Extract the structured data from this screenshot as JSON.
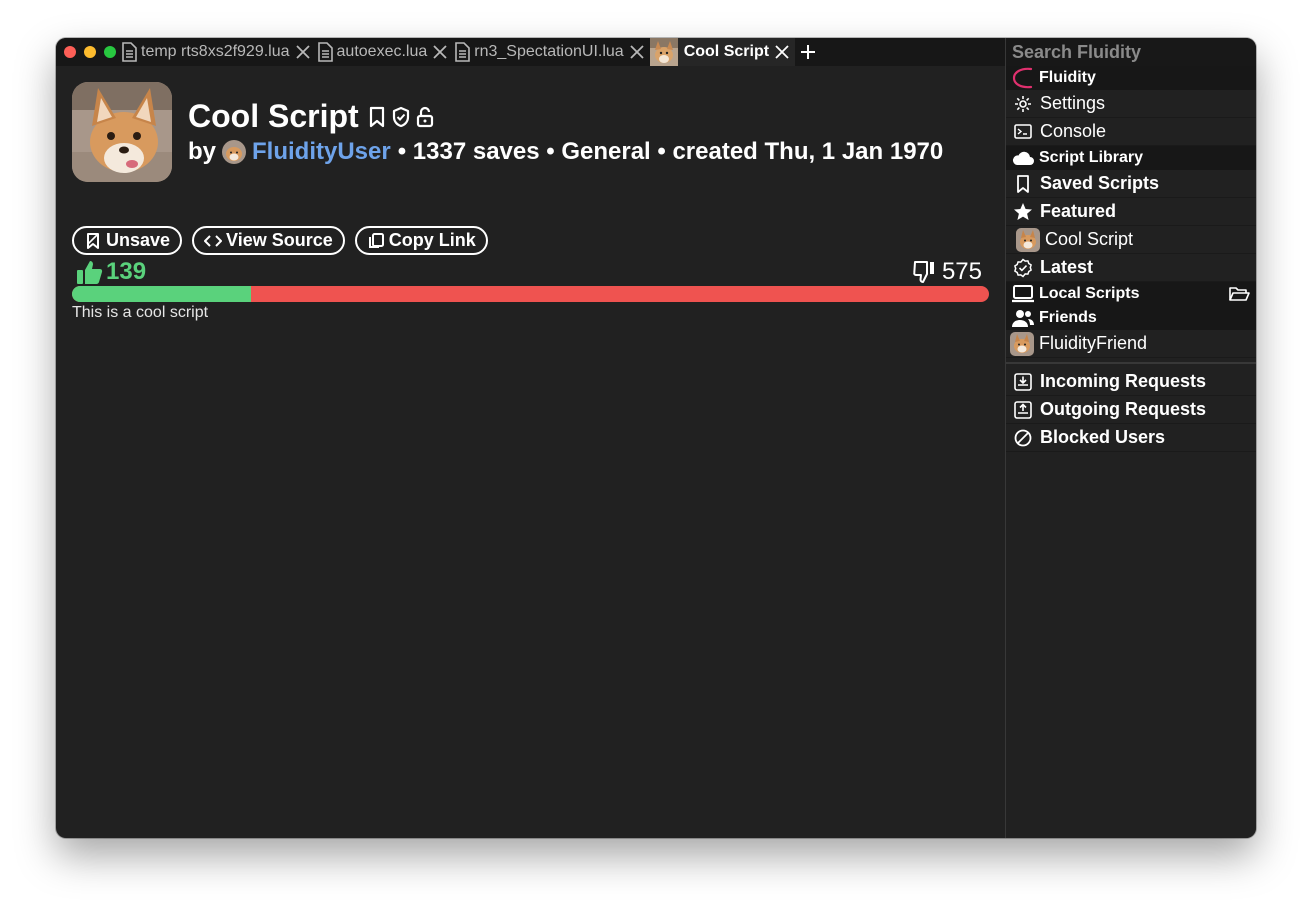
{
  "tabs": [
    {
      "label": "temp rts8xs2f929.lua",
      "icon": "document-icon",
      "active": false
    },
    {
      "label": "autoexec.lua",
      "icon": "document-icon",
      "active": false
    },
    {
      "label": "rn3_SpectationUI.lua",
      "icon": "document-icon",
      "active": false
    },
    {
      "label": "Cool Script",
      "icon": "fox-thumbnail",
      "active": true
    }
  ],
  "script": {
    "title": "Cool Script",
    "by": "by",
    "author": "FluidityUser",
    "details": "• 1337 saves • General • created Thu, 1 Jan 1970",
    "buttons": {
      "unsave": "Unsave",
      "view_source": "View Source",
      "copy_link": "Copy Link"
    },
    "likes": "139",
    "dislikes": "575",
    "like_ratio": 0.195,
    "description": "This is a cool script"
  },
  "sidebar": {
    "search_placeholder": "Search Fluidity",
    "fluidity_header": "Fluidity",
    "settings": "Settings",
    "console": "Console",
    "library_header": "Script Library",
    "saved_scripts": "Saved Scripts",
    "featured": "Featured",
    "featured_item": "Cool Script",
    "latest": "Latest",
    "local_header": "Local Scripts",
    "friends_header": "Friends",
    "friend_item": "FluidityFriend",
    "incoming": "Incoming Requests",
    "outgoing": "Outgoing Requests",
    "blocked": "Blocked Users"
  },
  "colors": {
    "accent_like": "#5ad27c",
    "accent_dislike": "#ef5350",
    "user_link": "#6ea3ea",
    "fluidity_logo": "#e0306e"
  }
}
